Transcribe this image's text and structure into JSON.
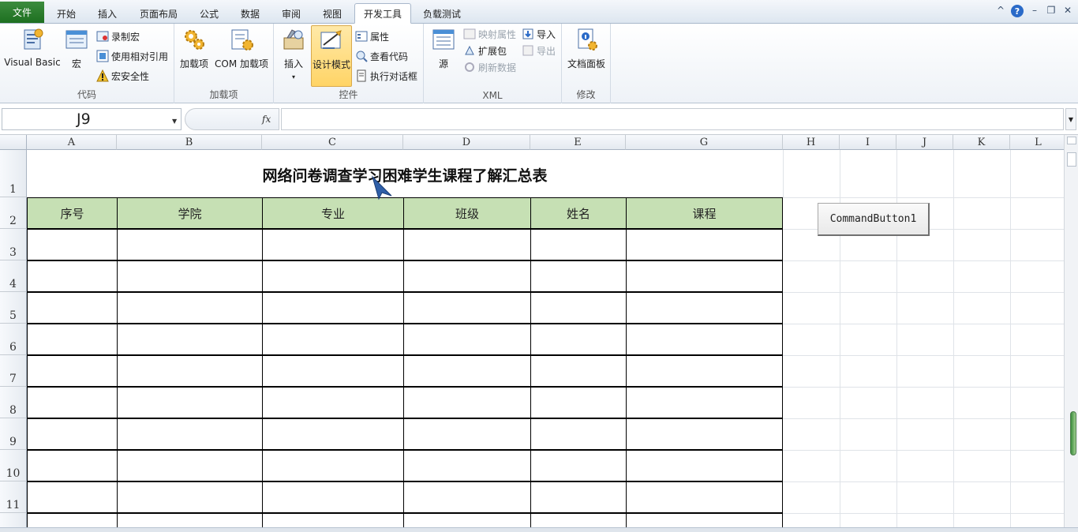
{
  "tabs": {
    "file": "文件",
    "items": [
      "开始",
      "插入",
      "页面布局",
      "公式",
      "数据",
      "审阅",
      "视图",
      "开发工具",
      "负载测试"
    ],
    "active": "开发工具"
  },
  "window_controls": {
    "minimize_ribbon": "^",
    "help": "?",
    "minimize": "–",
    "restore": "❐",
    "close": "✕"
  },
  "ribbon": {
    "code": {
      "label": "代码",
      "visual_basic": "Visual Basic",
      "macro": "宏",
      "record_macro": "录制宏",
      "use_relative": "使用相对引用",
      "macro_security": "宏安全性"
    },
    "addins": {
      "label": "加载项",
      "addins": "加载项",
      "com_addins": "COM 加载项"
    },
    "controls": {
      "label": "控件",
      "insert": "插入",
      "design_mode": "设计模式",
      "properties": "属性",
      "view_code": "查看代码",
      "run_dialog": "执行对话框"
    },
    "xml": {
      "label": "XML",
      "source": "源",
      "map_properties": "映射属性",
      "expansion_packs": "扩展包",
      "refresh_data": "刷新数据",
      "import": "导入",
      "export": "导出"
    },
    "modify": {
      "label": "修改",
      "document_panel": "文档面板"
    }
  },
  "formula_bar": {
    "name_box": "J9",
    "fx": "fx",
    "formula": ""
  },
  "sheet": {
    "columns": [
      "A",
      "B",
      "C",
      "D",
      "E",
      "G",
      "H",
      "I",
      "J",
      "K",
      "L"
    ],
    "rows": [
      "1",
      "2",
      "3",
      "4",
      "5",
      "6",
      "7",
      "8",
      "9",
      "10",
      "11"
    ],
    "title": "网络问卷调查学习困难学生课程了解汇总表",
    "headers": [
      "序号",
      "学院",
      "专业",
      "班级",
      "姓名",
      "课程"
    ],
    "command_button": "CommandButton1"
  },
  "colors": {
    "file_tab": "#1d6f20",
    "header_fill": "#c6e0b4",
    "design_mode_active": "#ffd466"
  }
}
